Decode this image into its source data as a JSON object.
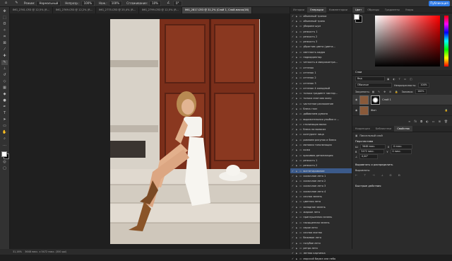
{
  "options_bar": {
    "mode_label": "Режим:",
    "mode_value": "Нормальный",
    "opacity_label": "Непрозр.:",
    "opacity_value": "100%",
    "flow_label": "Наж.:",
    "flow_value": "100%",
    "smoothing_label": "Сглаживание:",
    "smoothing_value": "10%",
    "angle_value": "0°",
    "share_label": "Публикация"
  },
  "tabs": [
    {
      "label": "IMG_2761.CR3 @ 12,5% (R...",
      "active": false
    },
    {
      "label": "IMG_2769.CR3 @ 12,2% (R...",
      "active": false
    },
    {
      "label": "IMG_2775.CR3 @ 25,4% (R...",
      "active": false
    },
    {
      "label": "IMG_2799.CR3 @ 12,5% (R...",
      "active": false
    },
    {
      "label": "IMG_2817.CR3 @ 31,2% (Слой 1, Слой-маска/16)",
      "active": true
    }
  ],
  "status_bar": {
    "zoom": "31,16%",
    "size": "3648 пикс. x 5472 пикс. (300 ppi)"
  },
  "actions_panel": {
    "tabs": [
      "Истории",
      "Операции",
      "Комментарии"
    ],
    "items": [
      {
        "label": "объемный тряпки",
        "expanded": false,
        "selected": false
      },
      {
        "label": "объемный тряпк",
        "expanded": false,
        "selected": false
      },
      {
        "label": "убираем шум",
        "expanded": false,
        "selected": false
      },
      {
        "label": "резкостъ 1",
        "expanded": false,
        "selected": false
      },
      {
        "label": "резкость 2",
        "expanded": false,
        "selected": false
      },
      {
        "label": "резкость 3",
        "expanded": false,
        "selected": false
      },
      {
        "label": "убраттив цвета (цвета...",
        "expanded": false,
        "selected": false
      },
      {
        "label": "светлость кадра",
        "expanded": false,
        "selected": false
      },
      {
        "label": "подкорректор",
        "expanded": false,
        "selected": false
      },
      {
        "label": "четкость и микроконтра...",
        "expanded": false,
        "selected": false
      },
      {
        "label": "оттенок",
        "expanded": false,
        "selected": false
      },
      {
        "label": "оттенок 1",
        "expanded": false,
        "selected": false
      },
      {
        "label": "оттенок 2",
        "expanded": false,
        "selected": false
      },
      {
        "label": "оттенок 3",
        "expanded": false,
        "selected": false
      },
      {
        "label": "оттенок 4 холодный",
        "expanded": false,
        "selected": false
      },
      {
        "label": "только градиент пиктор...",
        "expanded": false,
        "selected": false
      },
      {
        "label": "только смягчаю кожу",
        "expanded": false,
        "selected": false
      },
      {
        "label": "частотное разложение",
        "expanded": false,
        "selected": false
      },
      {
        "label": "блеск глаз",
        "expanded": false,
        "selected": false
      },
      {
        "label": "добавляем румяна",
        "expanded": false,
        "selected": false
      },
      {
        "label": "выразительная улыбка и ...",
        "expanded": false,
        "selected": false
      },
      {
        "label": "стилизация волос",
        "expanded": false,
        "selected": false
      },
      {
        "label": "блеск на волосах",
        "expanded": false,
        "selected": false
      },
      {
        "label": "контуринг лица",
        "expanded": false,
        "selected": false
      },
      {
        "label": "ровняем рисунок и блеск",
        "expanded": false,
        "selected": false
      },
      {
        "label": "матовая тонализация",
        "expanded": false,
        "selected": false
      },
      {
        "label": "кожа",
        "expanded": false,
        "selected": false
      },
      {
        "label": "красивая детализация",
        "expanded": false,
        "selected": false
      },
      {
        "label": "резкость 1",
        "expanded": false,
        "selected": false
      },
      {
        "label": "резкость 2",
        "expanded": false,
        "selected": false
      },
      {
        "label": "вигнетирование",
        "expanded": false,
        "selected": true
      },
      {
        "label": "сказочное лето 1",
        "expanded": false,
        "selected": false
      },
      {
        "label": "сказочное лето 2",
        "expanded": false,
        "selected": false
      },
      {
        "label": "сказочное лето 3",
        "expanded": false,
        "selected": false
      },
      {
        "label": "сказочное лето 4",
        "expanded": false,
        "selected": false
      },
      {
        "label": "сочная зелень",
        "expanded": false,
        "selected": false
      },
      {
        "label": "цветная лето",
        "expanded": false,
        "selected": false
      },
      {
        "label": "холодное зелень",
        "expanded": false,
        "selected": false
      },
      {
        "label": "жаркое лето",
        "expanded": false,
        "selected": false
      },
      {
        "label": "приглушенная зелень",
        "expanded": false,
        "selected": false
      },
      {
        "label": "насыщенная зелень",
        "expanded": false,
        "selected": false
      },
      {
        "label": "серое лето",
        "expanded": false,
        "selected": false
      },
      {
        "label": "сочная листва",
        "expanded": false,
        "selected": false
      },
      {
        "label": "бежевое лето",
        "expanded": false,
        "selected": false
      },
      {
        "label": "голубое лето",
        "expanded": false,
        "selected": false
      },
      {
        "label": "ретро лето",
        "expanded": false,
        "selected": false
      },
      {
        "label": "летняя картинка",
        "expanded": false,
        "selected": false
      },
      {
        "label": "морской бирюз или небо",
        "expanded": false,
        "selected": false
      }
    ]
  },
  "color_panel": {
    "tabs": [
      "Цвет",
      "Образцы",
      "Градиенты",
      "Узоры"
    ]
  },
  "layers_panel": {
    "title": "Слои",
    "search_label": "Вид",
    "blend_mode": "Обычные",
    "opacity_label": "Непрозрачность:",
    "opacity_value": "100%",
    "lock_label": "Закрепить:",
    "fill_label": "Заливка:",
    "fill_value": "100%",
    "layers": [
      {
        "name": "Слой 1",
        "selected": true
      },
      {
        "name": "Фон",
        "selected": false
      }
    ]
  },
  "properties_panel": {
    "tabs": [
      "Коррекция",
      "Библиотеки",
      "Свойства"
    ],
    "layer_type": "Пиксельный слой",
    "transform_title": "Перспектива",
    "w_label": "Ш",
    "w_value": "3648 пикс.",
    "h_label": "В",
    "h_value": "5472 пикс.",
    "x_label": "X",
    "x_value": "0 пикс.",
    "y_label": "Y",
    "y_value": "0 пикс.",
    "angle_value": "0,00°",
    "align_title": "Выровнять и распределить",
    "align_sub": "Выровнять:",
    "quick_title": "Быстрые действия"
  },
  "colors": {
    "accent": "#2f7ae5",
    "selection": "#3b5a8a",
    "door": "#7a2e1a"
  }
}
